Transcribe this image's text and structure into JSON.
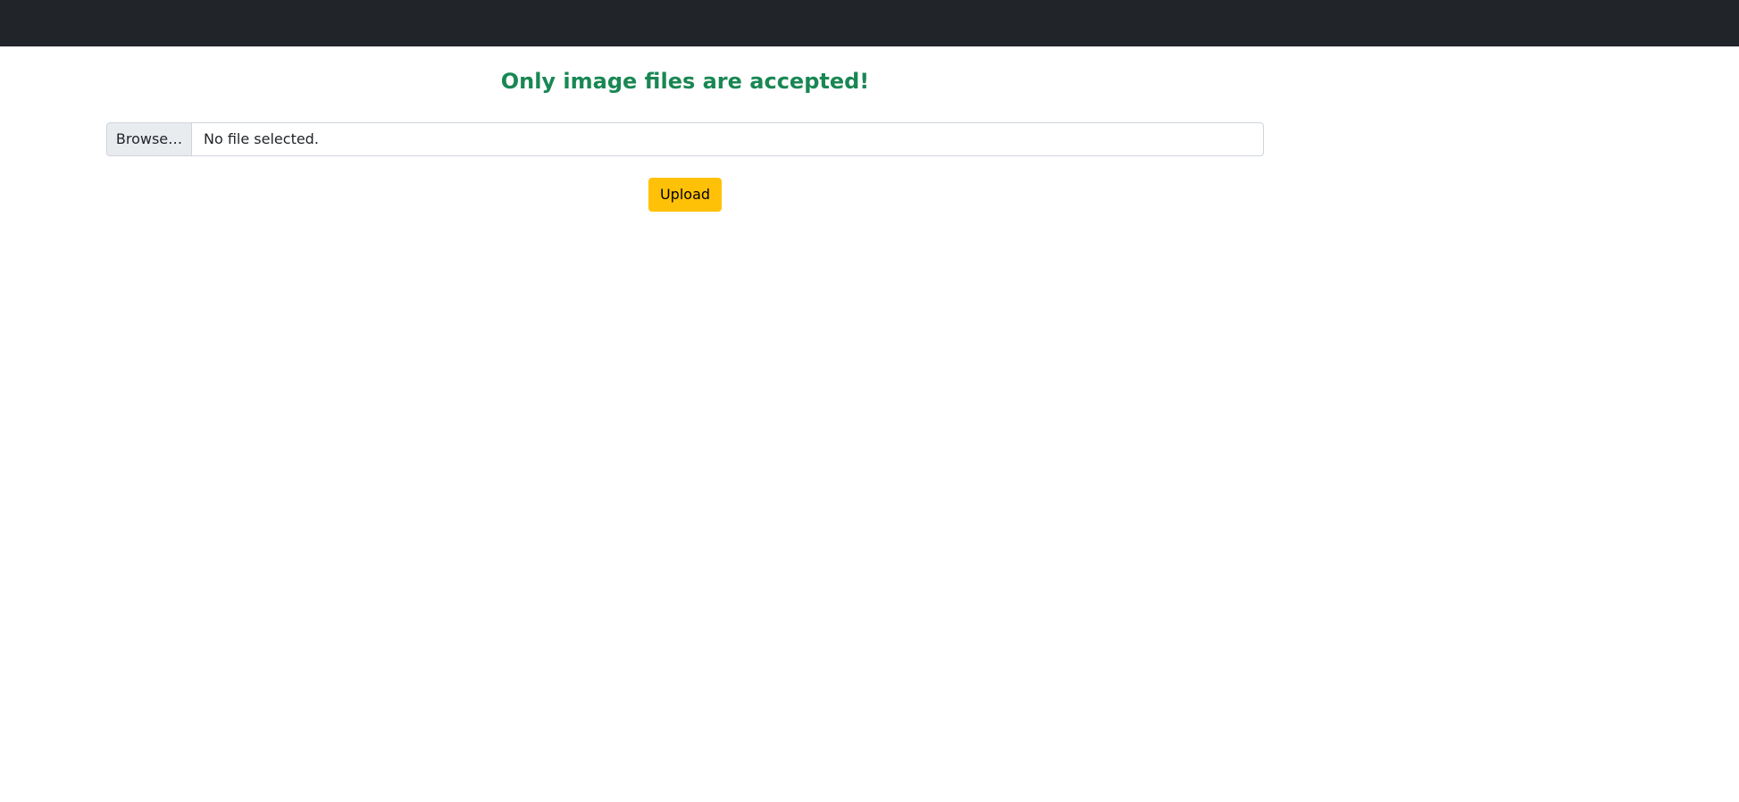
{
  "navbar": {
    "background": "#212529"
  },
  "message": {
    "text": "Only image files are accepted!",
    "color": "#198754"
  },
  "file_input": {
    "browse_label": "Browse…",
    "status_text": "No file selected."
  },
  "upload_button": {
    "label": "Upload",
    "color": "#ffc107"
  }
}
